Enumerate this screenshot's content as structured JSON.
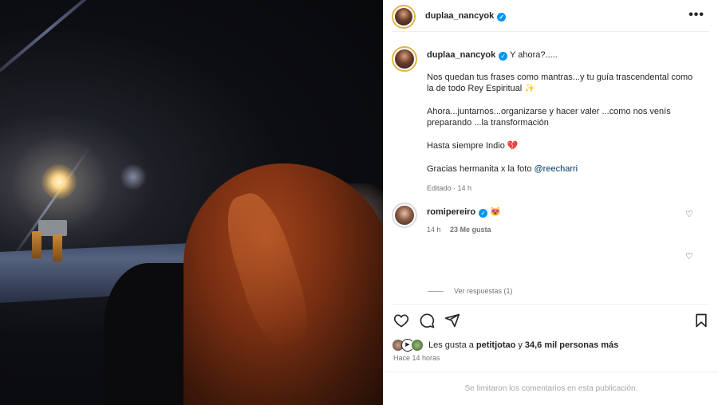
{
  "post": {
    "username": "duplaa_nancyok",
    "more_label": "•••"
  },
  "caption": {
    "username": "duplaa_nancyok",
    "first_line": "Y ahora?.....",
    "p1": "Nos quedan tus frases como mantras...y tu guía trascendental como la de todo Rey Espiritual ✨",
    "p2": "Ahora...juntarnos...organizarse y hacer valer ...como nos venís preparando ...la transformación",
    "p3": "Hasta siempre Indio 💔",
    "p4_text": "Gracias hermanita x la foto ",
    "p4_mention": "@reecharri",
    "meta": "Editado · 14 h"
  },
  "comment": {
    "username": "romipereiro",
    "text": "😻",
    "time": "14 h",
    "likes": "23 Me gusta",
    "replies_label": "Ver respuestas (1)"
  },
  "likes": {
    "prefix": "Les gusta a",
    "user": "petitjotao",
    "connector": "y",
    "others": "34,6 mil personas más"
  },
  "posted_ago": "Hace 14 horas",
  "footer": "Se limitaron los comentarios en esta publicación.",
  "icons": [
    "heart-icon",
    "comment-icon",
    "share-icon",
    "bookmark-icon",
    "more-icon",
    "verified-icon"
  ]
}
